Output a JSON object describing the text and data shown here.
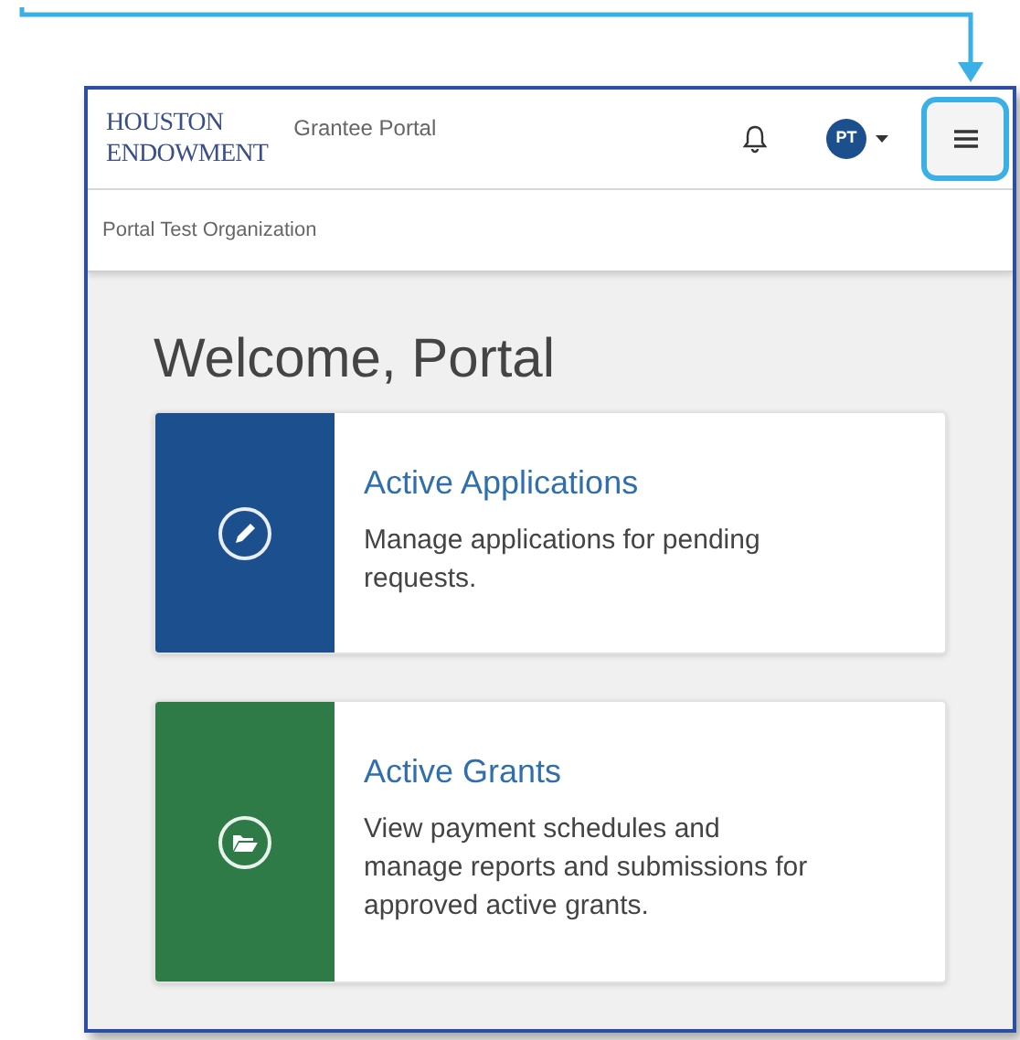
{
  "header": {
    "logo_line_1": "HOUSTON",
    "logo_line_2": "ENDOWMENT",
    "portal_name": "Grantee Portal",
    "avatar_initials": "PT",
    "menu_highlighted": true
  },
  "subheader": {
    "organization": "Portal Test Organization"
  },
  "welcome": "Welcome, Portal",
  "cards": [
    {
      "kind": "applications",
      "color": "#1b4f8e",
      "title": "Active Applications",
      "description": "Manage applications for pending requests."
    },
    {
      "kind": "grants",
      "color": "#2e7b47",
      "title": "Active Grants",
      "description": "View payment schedules and manage reports and submissions for approved active grants."
    }
  ]
}
